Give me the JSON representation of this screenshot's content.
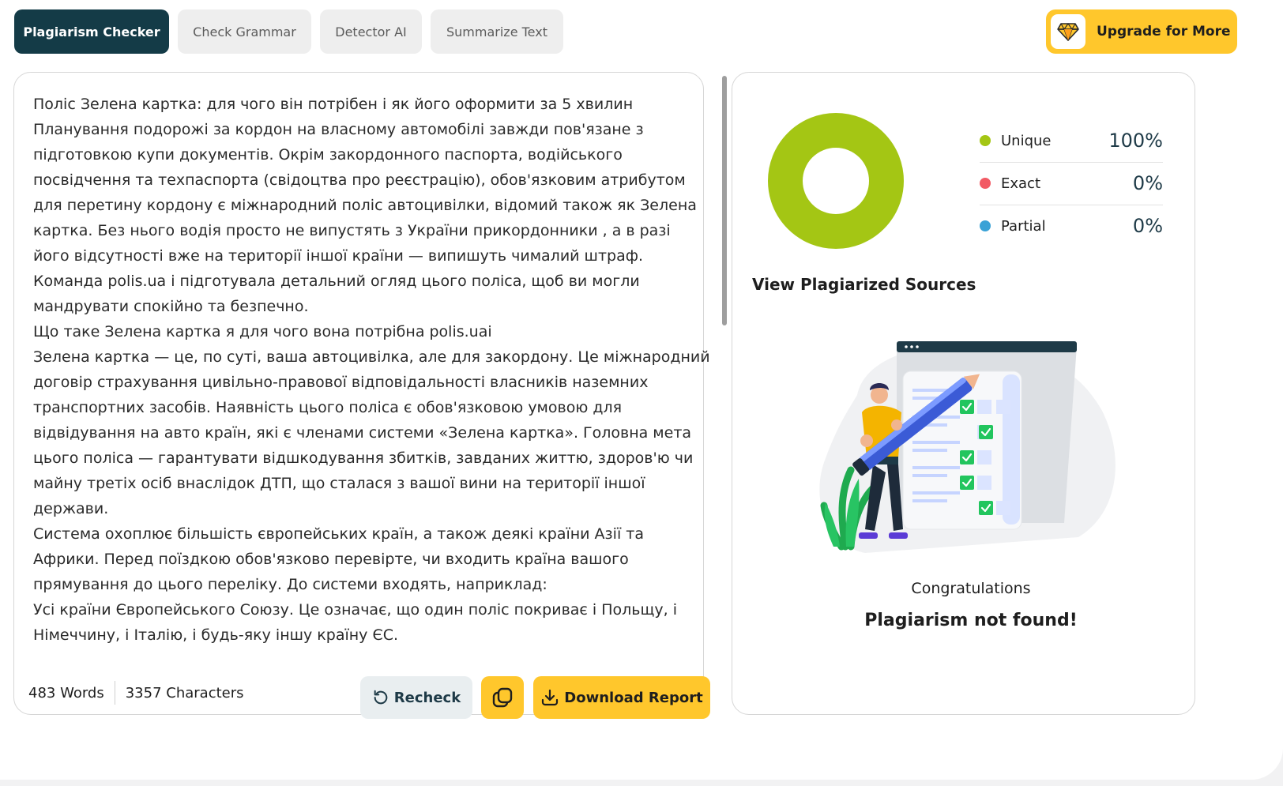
{
  "tabs": [
    {
      "label": "Plagiarism Checker",
      "active": true
    },
    {
      "label": "Check Grammar",
      "active": false
    },
    {
      "label": "Detector AI",
      "active": false
    },
    {
      "label": "Summarize Text",
      "active": false
    }
  ],
  "upgrade": {
    "label": "Upgrade for More",
    "icon": "diamond-icon"
  },
  "editor": {
    "paragraphs": [
      "Поліс Зелена картка: для чого він потрібен і як його оформити за 5 хвилин",
      "Планування подорожі за кордон на власному автомобілі завжди пов'язане з підготовкою купи документів. Окрім закордонного паспорта, водійського посвідчення та техпаспорта (свідоцтва про реєстрацію), обов'язковим атрибутом для перетину кордону є міжнародний поліс автоцивілки, відомий також як Зелена картка. Без нього водія просто не випустять з України прикордонники , а в разі його відсутності вже на території іншої країни — випишуть чималий штраф.",
      "Команда polis.ua і підготувала детальний огляд цього поліса, щоб ви могли мандрувати спокійно та безпечно.",
      "Що таке Зелена картка я для чого вона потрібна polis.uai",
      "Зелена картка — це, по суті, ваша автоцивілка, але для закордону. Це міжнародний договір страхування цивільно-правової відповідальності власників наземних транспортних засобів. Наявність цього поліса є обов'язковою умовою для відвідування на авто країн, які є членами системи «Зелена картка». Головна мета цього поліса — гарантувати відшкодування збитків, завданих життю, здоров'ю чи майну третіх осіб внаслідок ДТП, що сталася з вашої вини на території іншої держави.",
      "Система охоплює більшість європейських країн, а також деякі країни Азії та Африки. Перед поїздкою обов'язково перевірте, чи входить країна вашого прямування до цього переліку. До системи входять, наприклад:",
      "Усі країни Європейського Союзу. Це означає, що один поліс покриває і Польщу, і Німеччину, і Італію, і будь-яку іншу країну ЄС."
    ],
    "scroll_fraction": 0.42
  },
  "stats": {
    "words": "483 Words",
    "characters": "3357 Characters"
  },
  "buttons": {
    "recheck": "Recheck",
    "download": "Download Report"
  },
  "results": {
    "items": [
      {
        "name": "Unique",
        "value": "100%",
        "color": "#a4c614"
      },
      {
        "name": "Exact",
        "value": "0%",
        "color": "#f25a64"
      },
      {
        "name": "Partial",
        "value": "0%",
        "color": "#3aa2d6"
      }
    ],
    "donut": {
      "unique": 100,
      "exact": 0,
      "partial": 0
    },
    "sources_title": "View Plagiarized Sources",
    "congrats": "Congratulations",
    "message": "Plagiarism not found!"
  },
  "colors": {
    "primary_dark": "#143b47",
    "accent_yellow": "#ffc72c",
    "unique_green": "#a4c614"
  }
}
